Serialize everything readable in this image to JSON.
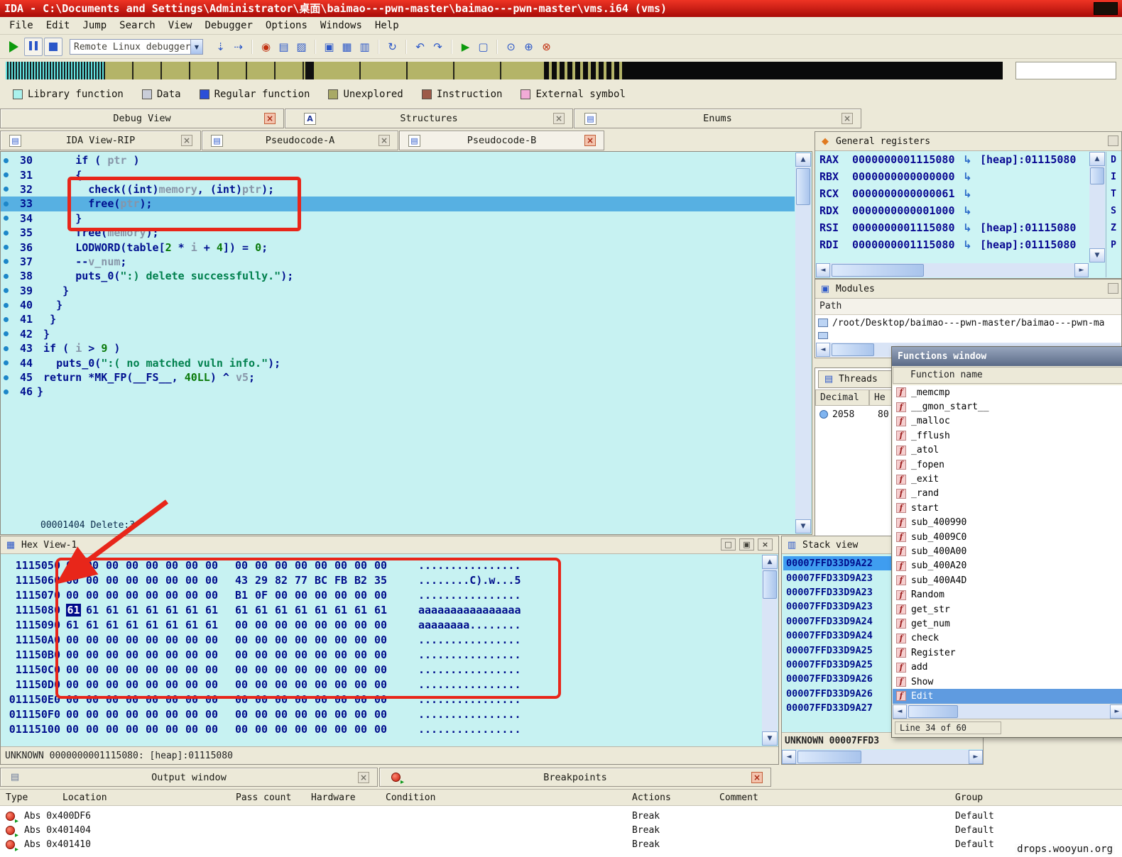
{
  "titlebar": {
    "title": "IDA - C:\\Documents and Settings\\Administrator\\桌面\\baimao---pwn-master\\baimao---pwn-master\\vms.i64 (vms)"
  },
  "menubar": {
    "items": [
      "File",
      "Edit",
      "Jump",
      "Search",
      "View",
      "Debugger",
      "Options",
      "Windows",
      "Help"
    ]
  },
  "toolbar": {
    "debugger_combo": "Remote Linux debugger",
    "icons": [
      {
        "name": "step-into",
        "glyph": "⇣",
        "color": "#2b57c8"
      },
      {
        "name": "step-over",
        "glyph": "⇢",
        "color": "#2b57c8"
      },
      {
        "sep": true
      },
      {
        "name": "toggle-breakpoint",
        "glyph": "◉",
        "color": "#c23010"
      },
      {
        "name": "breakpoint-list",
        "glyph": "▤",
        "color": "#2b57c8"
      },
      {
        "name": "edit-breakpoint",
        "glyph": "▨",
        "color": "#2b57c8"
      },
      {
        "sep": true
      },
      {
        "name": "open-ida-view",
        "glyph": "▣",
        "color": "#2b57c8"
      },
      {
        "name": "open-hex-view",
        "glyph": "▦",
        "color": "#2b57c8"
      },
      {
        "name": "open-structures",
        "glyph": "▥",
        "color": "#2b57c8"
      },
      {
        "sep": true
      },
      {
        "name": "refresh",
        "glyph": "↻",
        "color": "#2b57c8"
      },
      {
        "sep": true
      },
      {
        "name": "jump-back",
        "glyph": "↶",
        "color": "#2b57c8"
      },
      {
        "name": "jump-forward",
        "glyph": "↷",
        "color": "#2b57c8"
      },
      {
        "sep": true
      },
      {
        "name": "run-trace",
        "glyph": "▶",
        "color": "#0c9a0c"
      },
      {
        "name": "windows-list",
        "glyph": "▢",
        "color": "#2b57c8"
      },
      {
        "sep": true
      },
      {
        "name": "trace-options",
        "glyph": "⊙",
        "color": "#2b57c8"
      },
      {
        "name": "stack-trace",
        "glyph": "⊕",
        "color": "#2b57c8"
      },
      {
        "name": "kill-process",
        "glyph": "⊗",
        "color": "#c23010"
      }
    ]
  },
  "legend": {
    "items": [
      {
        "label": "Library function",
        "color": "#aaf1ec"
      },
      {
        "label": "Data",
        "color": "#c9cdd8"
      },
      {
        "label": "Regular function",
        "color": "#2b4fd8"
      },
      {
        "label": "Unexplored",
        "color": "#a9a966"
      },
      {
        "label": "Instruction",
        "color": "#9d5a49"
      },
      {
        "label": "External symbol",
        "color": "#f2abd7"
      }
    ]
  },
  "tabs_top": {
    "items": [
      "Debug View",
      "Structures",
      "Enums"
    ]
  },
  "tabs_doc": {
    "items": [
      "IDA View-RIP",
      "Pseudocode-A",
      "Pseudocode-B"
    ]
  },
  "pseudocode": {
    "status": "00001404 Delete:3",
    "lines": [
      {
        "num": "30",
        "ind": 6,
        "segs": [
          [
            "if ( ",
            "d"
          ],
          [
            "ptr",
            "v"
          ],
          [
            " )",
            "d"
          ]
        ]
      },
      {
        "num": "31",
        "ind": 6,
        "segs": [
          [
            "{",
            "d"
          ]
        ]
      },
      {
        "num": "32",
        "ind": 8,
        "segs": [
          [
            "check((int)",
            "d"
          ],
          [
            "memory",
            "v"
          ],
          [
            ", (int)",
            "d"
          ],
          [
            "ptr",
            "v"
          ],
          [
            ");",
            "d"
          ]
        ]
      },
      {
        "num": "33",
        "ind": 8,
        "hl": true,
        "segs": [
          [
            "free(",
            "d"
          ],
          [
            "ptr",
            "v"
          ],
          [
            ");",
            "d"
          ]
        ]
      },
      {
        "num": "34",
        "ind": 6,
        "segs": [
          [
            "}",
            "d"
          ]
        ]
      },
      {
        "num": "35",
        "ind": 6,
        "segs": [
          [
            "free(",
            "d"
          ],
          [
            "memory",
            "v"
          ],
          [
            ");",
            "d"
          ]
        ]
      },
      {
        "num": "36",
        "ind": 6,
        "segs": [
          [
            "LODWORD(table[",
            "d"
          ],
          [
            "2",
            "n"
          ],
          [
            " * ",
            "d"
          ],
          [
            "i",
            "v"
          ],
          [
            " + ",
            "d"
          ],
          [
            "4",
            "n"
          ],
          [
            "]) = ",
            "d"
          ],
          [
            "0",
            "n"
          ],
          [
            ";",
            "d"
          ]
        ]
      },
      {
        "num": "37",
        "ind": 6,
        "segs": [
          [
            "--",
            "d"
          ],
          [
            "v_num",
            "v"
          ],
          [
            ";",
            "d"
          ]
        ]
      },
      {
        "num": "38",
        "ind": 6,
        "segs": [
          [
            "puts_0(",
            "d"
          ],
          [
            "\":) delete successfully.\"",
            "s"
          ],
          [
            ");",
            "d"
          ]
        ]
      },
      {
        "num": "39",
        "ind": 4,
        "segs": [
          [
            "}",
            "d"
          ]
        ]
      },
      {
        "num": "40",
        "ind": 3,
        "segs": [
          [
            "}",
            "d"
          ]
        ]
      },
      {
        "num": "41",
        "ind": 2,
        "segs": [
          [
            "}",
            "d"
          ]
        ]
      },
      {
        "num": "42",
        "ind": 1,
        "segs": [
          [
            "}",
            "d"
          ]
        ]
      },
      {
        "num": "43",
        "ind": 1,
        "segs": [
          [
            "if ( ",
            "d"
          ],
          [
            "i",
            "v"
          ],
          [
            " > ",
            "d"
          ],
          [
            "9",
            "n"
          ],
          [
            " )",
            "d"
          ]
        ]
      },
      {
        "num": "44",
        "ind": 3,
        "segs": [
          [
            "puts_0(",
            "d"
          ],
          [
            "\":( no matched vuln info.\"",
            "s"
          ],
          [
            ");",
            "d"
          ]
        ]
      },
      {
        "num": "45",
        "ind": 1,
        "segs": [
          [
            "return *MK_FP(__FS__, ",
            "d"
          ],
          [
            "40LL",
            "n"
          ],
          [
            ") ^ ",
            "d"
          ],
          [
            "v5",
            "v"
          ],
          [
            ";",
            "d"
          ]
        ]
      },
      {
        "num": "46",
        "ind": 0,
        "segs": [
          [
            "}",
            "d"
          ]
        ]
      }
    ]
  },
  "registers": {
    "title": "General registers",
    "rows": [
      {
        "name": "RAX",
        "value": "0000000001115080",
        "ref": "[heap]:01115080"
      },
      {
        "name": "RBX",
        "value": "0000000000000000",
        "ref": ""
      },
      {
        "name": "RCX",
        "value": "0000000000000061",
        "ref": ""
      },
      {
        "name": "RDX",
        "value": "0000000000001000",
        "ref": ""
      },
      {
        "name": "RSI",
        "value": "0000000001115080",
        "ref": "[heap]:01115080"
      },
      {
        "name": "RDI",
        "value": "0000000001115080",
        "ref": "[heap]:01115080"
      }
    ],
    "flags": [
      "D",
      "I",
      "T",
      "S",
      "Z",
      "P"
    ]
  },
  "modules": {
    "title": "Modules",
    "column": "Path",
    "rows": [
      "/root/Desktop/baimao---pwn-master/baimao---pwn-ma"
    ]
  },
  "threads": {
    "tab": "Threads",
    "columns": [
      "Decimal",
      "He"
    ],
    "rows": [
      {
        "decimal": "2058",
        "hex": "80"
      }
    ]
  },
  "functions": {
    "title": "Functions window",
    "column": "Function name",
    "selected": "Edit",
    "status": "Line 34 of 60",
    "items": [
      "_memcmp",
      "__gmon_start__",
      "_malloc",
      "_fflush",
      "_atol",
      "_fopen",
      "_exit",
      "_rand",
      "start",
      "sub_400990",
      "sub_4009C0",
      "sub_400A00",
      "sub_400A20",
      "sub_400A4D",
      "Random",
      "get_str",
      "get_num",
      "check",
      "Register",
      "add",
      "Show",
      "Edit"
    ]
  },
  "stack": {
    "title": "Stack view",
    "selected_index": 0,
    "status": "UNKNOWN 00007FFD3",
    "rows": [
      "00007FFD33D9A22",
      "00007FFD33D9A23",
      "00007FFD33D9A23",
      "00007FFD33D9A23",
      "00007FFD33D9A24",
      "00007FFD33D9A24",
      "00007FFD33D9A25",
      "00007FFD33D9A25",
      "00007FFD33D9A26",
      "00007FFD33D9A26",
      "00007FFD33D9A27"
    ]
  },
  "hexview": {
    "title": "Hex View-1",
    "status": "UNKNOWN 0000000001115080: [heap]:01115080",
    "rows": [
      {
        "addr": "1115050",
        "b": [
          "00",
          "00",
          "00",
          "00",
          "00",
          "00",
          "00",
          "00",
          "00",
          "00",
          "00",
          "00",
          "00",
          "00",
          "00",
          "00"
        ],
        "ascii": "................"
      },
      {
        "addr": "1115060",
        "b": [
          "00",
          "00",
          "00",
          "00",
          "00",
          "00",
          "00",
          "00",
          "43",
          "29",
          "82",
          "77",
          "BC",
          "FB",
          "B2",
          "35"
        ],
        "ascii": "........C).w...5"
      },
      {
        "addr": "1115070",
        "b": [
          "00",
          "00",
          "00",
          "00",
          "00",
          "00",
          "00",
          "00",
          "B1",
          "0F",
          "00",
          "00",
          "00",
          "00",
          "00",
          "00"
        ],
        "ascii": "................"
      },
      {
        "addr": "1115080",
        "sel": 0,
        "b": [
          "61",
          "61",
          "61",
          "61",
          "61",
          "61",
          "61",
          "61",
          "61",
          "61",
          "61",
          "61",
          "61",
          "61",
          "61",
          "61"
        ],
        "ascii": "aaaaaaaaaaaaaaaa"
      },
      {
        "addr": "1115090",
        "b": [
          "61",
          "61",
          "61",
          "61",
          "61",
          "61",
          "61",
          "61",
          "00",
          "00",
          "00",
          "00",
          "00",
          "00",
          "00",
          "00"
        ],
        "ascii": "aaaaaaaa........"
      },
      {
        "addr": "11150A0",
        "b": [
          "00",
          "00",
          "00",
          "00",
          "00",
          "00",
          "00",
          "00",
          "00",
          "00",
          "00",
          "00",
          "00",
          "00",
          "00",
          "00"
        ],
        "ascii": "................"
      },
      {
        "addr": "11150B0",
        "b": [
          "00",
          "00",
          "00",
          "00",
          "00",
          "00",
          "00",
          "00",
          "00",
          "00",
          "00",
          "00",
          "00",
          "00",
          "00",
          "00"
        ],
        "ascii": "................"
      },
      {
        "addr": "11150C0",
        "b": [
          "00",
          "00",
          "00",
          "00",
          "00",
          "00",
          "00",
          "00",
          "00",
          "00",
          "00",
          "00",
          "00",
          "00",
          "00",
          "00"
        ],
        "ascii": "................"
      },
      {
        "addr": "11150D0",
        "b": [
          "00",
          "00",
          "00",
          "00",
          "00",
          "00",
          "00",
          "00",
          "00",
          "00",
          "00",
          "00",
          "00",
          "00",
          "00",
          "00"
        ],
        "ascii": "................"
      },
      {
        "addr": "011150E0",
        "b": [
          "00",
          "00",
          "00",
          "00",
          "00",
          "00",
          "00",
          "00",
          "00",
          "00",
          "00",
          "00",
          "00",
          "00",
          "00",
          "00"
        ],
        "ascii": "................"
      },
      {
        "addr": "011150F0",
        "b": [
          "00",
          "00",
          "00",
          "00",
          "00",
          "00",
          "00",
          "00",
          "00",
          "00",
          "00",
          "00",
          "00",
          "00",
          "00",
          "00"
        ],
        "ascii": "................"
      },
      {
        "addr": "01115100",
        "b": [
          "00",
          "00",
          "00",
          "00",
          "00",
          "00",
          "00",
          "00",
          "00",
          "00",
          "00",
          "00",
          "00",
          "00",
          "00",
          "00"
        ],
        "ascii": "................"
      }
    ]
  },
  "bottom_tabs": {
    "items": [
      "Output window",
      "Breakpoints"
    ]
  },
  "breakpoints": {
    "columns": [
      "Type",
      "Location",
      "Pass count",
      "Hardware",
      "Condition",
      "Actions",
      "Comment",
      "Group"
    ],
    "rows": [
      {
        "location": "Abs 0x400DF6",
        "action": "Break",
        "group": "Default"
      },
      {
        "location": "Abs 0x401404",
        "action": "Break",
        "group": "Default"
      },
      {
        "location": "Abs 0x401410",
        "action": "Break",
        "group": "Default"
      }
    ]
  },
  "watermark": {
    "text": "drops.wooyun.org"
  }
}
